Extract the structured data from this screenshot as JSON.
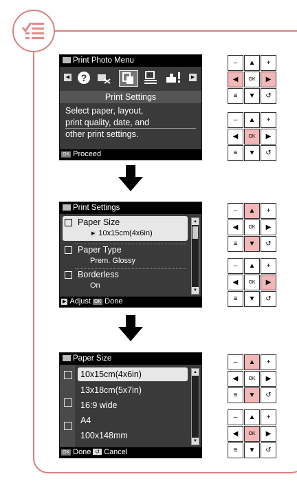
{
  "icons": {
    "badge": "checklist-icon",
    "step_arrow": "down-arrow-icon"
  },
  "colors": {
    "frame": "#d98080",
    "highlight": "#f2b7b7"
  },
  "screen1": {
    "title": "Print Photo Menu",
    "section_title": "Print Settings",
    "description_lines": [
      "Select paper, layout,",
      "print quality, date, and",
      "other print settings."
    ],
    "footer_ok": "OK",
    "footer_label": "Proceed",
    "menu_icons": [
      "help-icon",
      "cancel-fax-icon",
      "print-settings-icon",
      "layout-icon",
      "maintenance-icon"
    ],
    "selected_icon": "print-settings-icon"
  },
  "screen2": {
    "title": "Print Settings",
    "items": [
      {
        "label": "Paper Size",
        "value": "10x15cm(4x6in)",
        "selected": true
      },
      {
        "label": "Paper Type",
        "value": "Prem. Glossy",
        "selected": false
      },
      {
        "label": "Borderless",
        "value": "On",
        "selected": false
      }
    ],
    "footer_adjust": "Adjust",
    "footer_ok": "OK",
    "footer_done": "Done"
  },
  "screen3": {
    "title": "Paper Size",
    "options": [
      "10x15cm(4x6in)",
      "13x18cm(5x7in)",
      "16:9 wide",
      "A4",
      "100x148mm"
    ],
    "selected_option": "10x15cm(4x6in)",
    "footer_ok": "OK",
    "footer_done": "Done",
    "footer_cancel": "Cancel"
  },
  "keypads": [
    {
      "highlight": [
        "left",
        "right"
      ]
    },
    {
      "highlight": [
        "ok"
      ]
    },
    {
      "highlight": [
        "up",
        "down"
      ]
    },
    {
      "highlight": [
        "right"
      ]
    },
    {
      "highlight": [
        "up",
        "down"
      ]
    },
    {
      "highlight": [
        "ok"
      ]
    }
  ],
  "keypad_labels": {
    "minus": "–",
    "up": "▲",
    "plus": "+",
    "left": "◀",
    "ok": "OK",
    "right": "▶",
    "menu": "≡",
    "down": "▼",
    "back": "↺"
  }
}
